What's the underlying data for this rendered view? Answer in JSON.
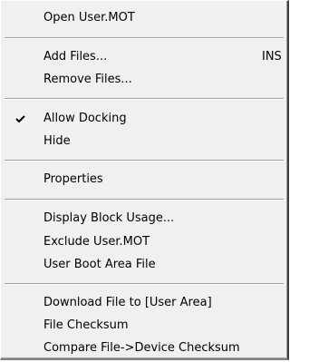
{
  "menu": {
    "items": [
      {
        "label": "Open User.MOT"
      },
      {
        "label": "Add Files...",
        "shortcut": "INS"
      },
      {
        "label": "Remove Files..."
      },
      {
        "label": "Allow Docking",
        "checked": true
      },
      {
        "label": "Hide"
      },
      {
        "label": "Properties"
      },
      {
        "label": "Display Block Usage..."
      },
      {
        "label": "Exclude User.MOT"
      },
      {
        "label": "User Boot Area File"
      },
      {
        "label": "Download File to [User Area]"
      },
      {
        "label": "File Checksum"
      },
      {
        "label": "Compare File->Device Checksum"
      }
    ],
    "check_icon": "checkmark-icon"
  }
}
